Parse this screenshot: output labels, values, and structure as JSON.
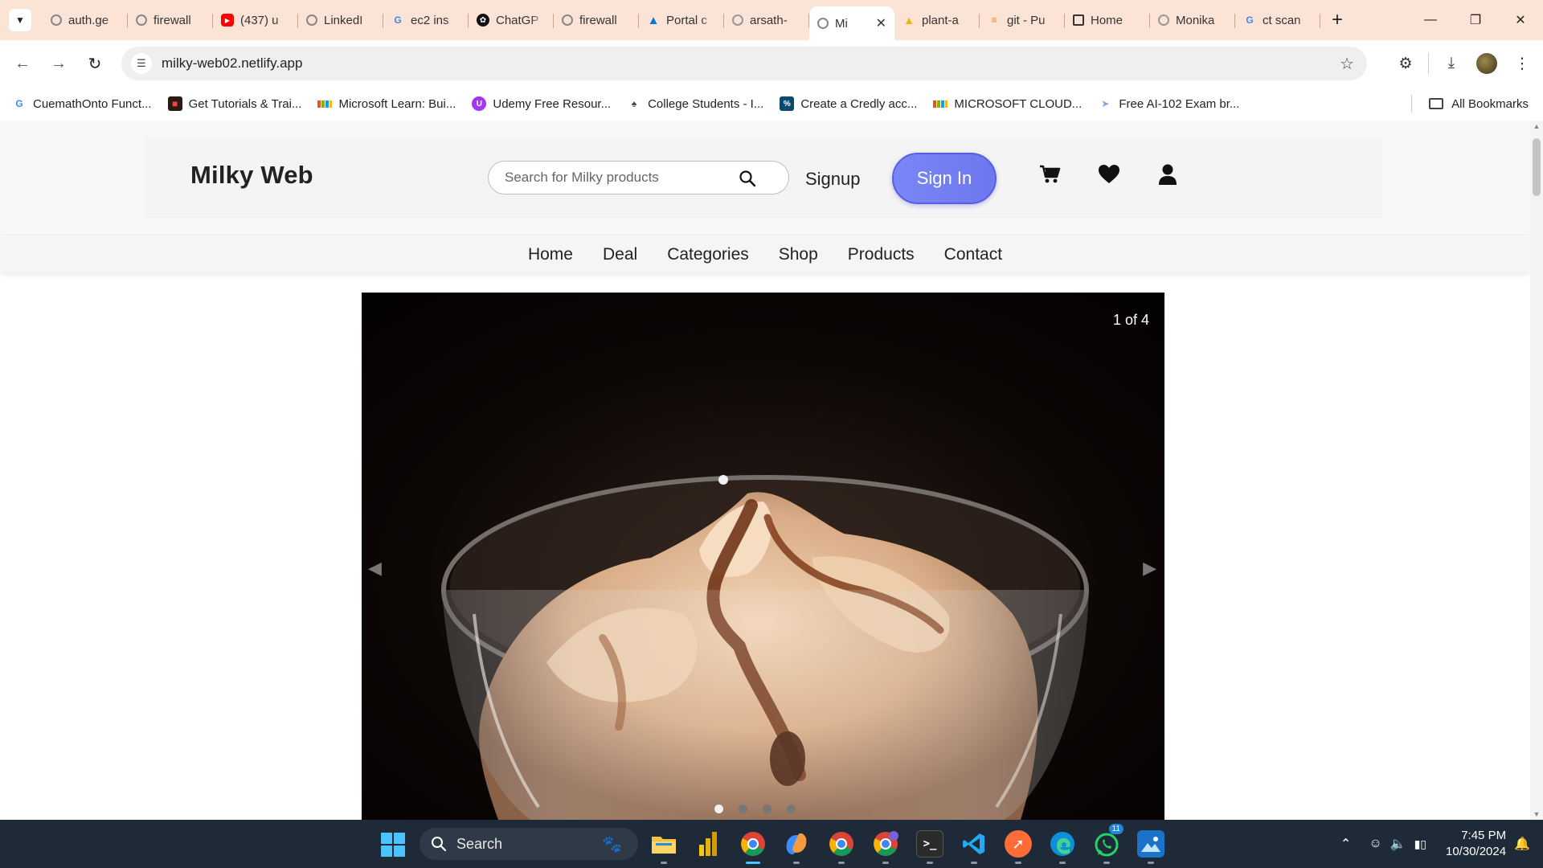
{
  "browser": {
    "tabs": [
      {
        "title": "auth.ge",
        "icon": "globe-icon"
      },
      {
        "title": "firewall",
        "icon": "globe-icon"
      },
      {
        "title": "(437) u",
        "icon": "youtube-icon"
      },
      {
        "title": "LinkedI",
        "icon": "globe-icon"
      },
      {
        "title": "ec2 ins",
        "icon": "google-icon"
      },
      {
        "title": "ChatGP",
        "icon": "chatgpt-icon"
      },
      {
        "title": "firewall",
        "icon": "globe-icon"
      },
      {
        "title": "Portal c",
        "icon": "azure-icon"
      },
      {
        "title": "arsath-",
        "icon": "github-icon"
      },
      {
        "title": "Mi",
        "icon": "globe-icon",
        "active": true
      },
      {
        "title": "plant-a",
        "icon": "drive-icon"
      },
      {
        "title": "git - Pu",
        "icon": "stackoverflow-icon"
      },
      {
        "title": "Home",
        "icon": "box-icon"
      },
      {
        "title": "Monika",
        "icon": "github-icon"
      },
      {
        "title": "ct scan",
        "icon": "google-icon"
      }
    ],
    "url": "milky-web02.netlify.app",
    "bookmarks": [
      {
        "label": "CuemathOnto Funct...",
        "icon": "google-icon"
      },
      {
        "label": "Get Tutorials & Trai...",
        "icon": "tutorials-icon"
      },
      {
        "label": "Microsoft Learn: Bui...",
        "icon": "microsoft-icon"
      },
      {
        "label": "Udemy Free Resour...",
        "icon": "udemy-icon"
      },
      {
        "label": "College Students - I...",
        "icon": "college-icon"
      },
      {
        "label": "Create a Credly acc...",
        "icon": "credly-icon"
      },
      {
        "label": "MICROSOFT CLOUD...",
        "icon": "microsoft-icon"
      },
      {
        "label": "Free AI-102 Exam br...",
        "icon": "exam-icon"
      }
    ],
    "all_bookmarks": "All Bookmarks"
  },
  "site": {
    "brand": "Milky Web",
    "search_placeholder": "Search for Milky products",
    "signup": "Signup",
    "signin": "Sign In",
    "nav": [
      "Home",
      "Deal",
      "Categories",
      "Shop",
      "Products",
      "Contact"
    ],
    "carousel": {
      "counter": "1 of 4",
      "current_slide": 1,
      "total_slides": 4
    }
  },
  "taskbar": {
    "search_label": "Search",
    "time": "7:45 PM",
    "date": "10/30/2024",
    "notification_badge": "11"
  },
  "colors": {
    "tabstrip": "#fbe3d6",
    "signin_button": "#7a86f6",
    "taskbar": "#1e2a38"
  }
}
